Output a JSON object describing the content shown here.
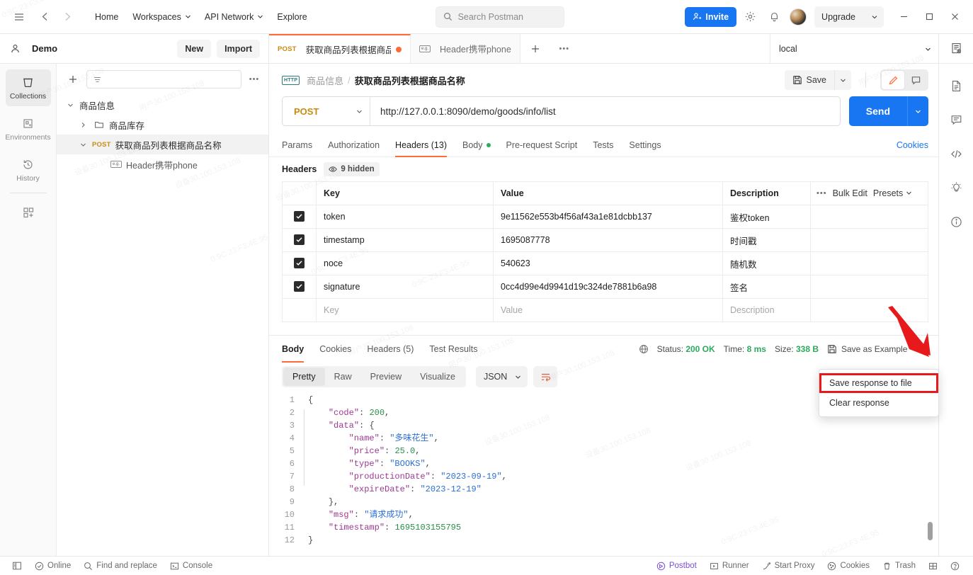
{
  "topbar": {
    "menu_icon": "hamburger-icon",
    "back_icon": "arrow-left-icon",
    "forward_icon": "arrow-right-icon",
    "home": "Home",
    "workspaces": "Workspaces",
    "api_network": "API Network",
    "explore": "Explore",
    "search_placeholder": "Search Postman",
    "invite": "Invite",
    "upgrade": "Upgrade"
  },
  "workspace": {
    "name": "Demo",
    "new_label": "New",
    "import_label": "Import"
  },
  "rail": {
    "items": [
      {
        "label": "Collections",
        "icon": "collections-icon"
      },
      {
        "label": "Environments",
        "icon": "environments-icon"
      },
      {
        "label": "History",
        "icon": "history-icon"
      }
    ],
    "more_icon": "apps-grid-plus-icon"
  },
  "tree": {
    "filter_placeholder": "",
    "nodes": [
      {
        "label": "商品信息",
        "type": "collection",
        "depth": 0,
        "expanded": true,
        "selected": false
      },
      {
        "label": "商品库存",
        "type": "folder",
        "depth": 1,
        "expanded": false,
        "selected": false
      },
      {
        "label": "获取商品列表根据商品名称",
        "type": "request",
        "method": "POST",
        "depth": 1,
        "expanded": true,
        "selected": true
      },
      {
        "label": "Header携带phone",
        "type": "example",
        "depth": 2,
        "expanded": false,
        "selected": false
      }
    ]
  },
  "tabs": {
    "items": [
      {
        "method": "POST",
        "label": "获取商品列表根据商品:",
        "active": true,
        "unsaved": true
      },
      {
        "method": "",
        "label": "Header携带phone",
        "active": false,
        "unsaved": false
      }
    ],
    "environment": "local"
  },
  "request": {
    "breadcrumb_parent": "商品信息",
    "breadcrumb_sep": "/",
    "breadcrumb_current": "获取商品列表根据商品名称",
    "save_label": "Save",
    "method": "POST",
    "url": "http://127.0.0.1:8090/demo/goods/info/list",
    "send_label": "Send",
    "tabs": [
      {
        "label": "Params",
        "active": false,
        "dot": false
      },
      {
        "label": "Authorization",
        "active": false,
        "dot": false
      },
      {
        "label": "Headers (13)",
        "active": true,
        "dot": false
      },
      {
        "label": "Body",
        "active": false,
        "dot": true
      },
      {
        "label": "Pre-request Script",
        "active": false,
        "dot": false
      },
      {
        "label": "Tests",
        "active": false,
        "dot": false
      },
      {
        "label": "Settings",
        "active": false,
        "dot": false
      }
    ],
    "cookies_link": "Cookies"
  },
  "headers_panel": {
    "caption": "Headers",
    "hidden_label": "9 hidden",
    "columns": [
      "Key",
      "Value",
      "Description"
    ],
    "bulk_edit": "Bulk Edit",
    "presets": "Presets",
    "rows": [
      {
        "checked": true,
        "key": "token",
        "value": "9e11562e553b4f56af43a1e81dcbb137",
        "description": "鉴权token"
      },
      {
        "checked": true,
        "key": "timestamp",
        "value": "1695087778",
        "description": "时间戳"
      },
      {
        "checked": true,
        "key": "noce",
        "value": "540623",
        "description": "随机数"
      },
      {
        "checked": true,
        "key": "signature",
        "value": "0cc4d99e4d9941d19c324de7881b6a98",
        "description": "签名"
      }
    ],
    "placeholder_row": {
      "key": "Key",
      "value": "Value",
      "description": "Description"
    }
  },
  "response": {
    "tabs": [
      {
        "label": "Body",
        "active": true
      },
      {
        "label": "Cookies",
        "active": false
      },
      {
        "label": "Headers (5)",
        "active": false
      },
      {
        "label": "Test Results",
        "active": false
      }
    ],
    "status_label": "Status:",
    "status_value": "200 OK",
    "time_label": "Time:",
    "time_value": "8 ms",
    "size_label": "Size:",
    "size_value": "338 B",
    "save_as_example": "Save as Example",
    "view_modes": [
      {
        "label": "Pretty",
        "active": true
      },
      {
        "label": "Raw",
        "active": false
      },
      {
        "label": "Preview",
        "active": false
      },
      {
        "label": "Visualize",
        "active": false
      }
    ],
    "format": "JSON",
    "wrap_icon": "wrap-lines-icon",
    "line_numbers": [
      1,
      2,
      3,
      4,
      5,
      6,
      7,
      8,
      9,
      10,
      11,
      12
    ],
    "body_lines": [
      [
        {
          "t": "{",
          "c": "pun"
        }
      ],
      [
        {
          "t": "    ",
          "c": "pun"
        },
        {
          "t": "\"code\"",
          "c": "key"
        },
        {
          "t": ": ",
          "c": "pun"
        },
        {
          "t": "200",
          "c": "num"
        },
        {
          "t": ",",
          "c": "pun"
        }
      ],
      [
        {
          "t": "    ",
          "c": "pun"
        },
        {
          "t": "\"data\"",
          "c": "key"
        },
        {
          "t": ": ",
          "c": "pun"
        },
        {
          "t": "{",
          "c": "pun"
        }
      ],
      [
        {
          "t": "        ",
          "c": "pun"
        },
        {
          "t": "\"name\"",
          "c": "key"
        },
        {
          "t": ": ",
          "c": "pun"
        },
        {
          "t": "\"多味花生\"",
          "c": "str"
        },
        {
          "t": ",",
          "c": "pun"
        }
      ],
      [
        {
          "t": "        ",
          "c": "pun"
        },
        {
          "t": "\"price\"",
          "c": "key"
        },
        {
          "t": ": ",
          "c": "pun"
        },
        {
          "t": "25.0",
          "c": "num"
        },
        {
          "t": ",",
          "c": "pun"
        }
      ],
      [
        {
          "t": "        ",
          "c": "pun"
        },
        {
          "t": "\"type\"",
          "c": "key"
        },
        {
          "t": ": ",
          "c": "pun"
        },
        {
          "t": "\"BOOKS\"",
          "c": "str"
        },
        {
          "t": ",",
          "c": "pun"
        }
      ],
      [
        {
          "t": "        ",
          "c": "pun"
        },
        {
          "t": "\"productionDate\"",
          "c": "key"
        },
        {
          "t": ": ",
          "c": "pun"
        },
        {
          "t": "\"2023-09-19\"",
          "c": "str"
        },
        {
          "t": ",",
          "c": "pun"
        }
      ],
      [
        {
          "t": "        ",
          "c": "pun"
        },
        {
          "t": "\"expireDate\"",
          "c": "key"
        },
        {
          "t": ": ",
          "c": "pun"
        },
        {
          "t": "\"2023-12-19\"",
          "c": "str"
        }
      ],
      [
        {
          "t": "    ",
          "c": "pun"
        },
        {
          "t": "},",
          "c": "pun"
        }
      ],
      [
        {
          "t": "    ",
          "c": "pun"
        },
        {
          "t": "\"msg\"",
          "c": "key"
        },
        {
          "t": ": ",
          "c": "pun"
        },
        {
          "t": "\"请求成功\"",
          "c": "str"
        },
        {
          "t": ",",
          "c": "pun"
        }
      ],
      [
        {
          "t": "    ",
          "c": "pun"
        },
        {
          "t": "\"timestamp\"",
          "c": "key"
        },
        {
          "t": ": ",
          "c": "pun"
        },
        {
          "t": "1695103155795",
          "c": "num"
        }
      ],
      [
        {
          "t": "}",
          "c": "pun"
        }
      ]
    ]
  },
  "context_menu": {
    "items": [
      {
        "label": "Save response to file",
        "highlighted": true
      },
      {
        "label": "Clear response",
        "highlighted": false
      }
    ]
  },
  "right_rail": {
    "items": [
      "collection-overview-icon",
      "documentation-icon",
      "comments-icon",
      "code-icon",
      "lightbulb-icon",
      "info-icon"
    ]
  },
  "statusbar": {
    "sidebar_icon": "panel-toggle-icon",
    "online": "Online",
    "find_replace": "Find and replace",
    "console": "Console",
    "postbot": "Postbot",
    "runner": "Runner",
    "start_proxy": "Start Proxy",
    "cookies": "Cookies",
    "trash": "Trash",
    "layout_icon": "layout-icon",
    "help_icon": "help-icon"
  },
  "colors": {
    "accent": "#ff6c37",
    "primary": "#1876f2",
    "success": "#2bab5b",
    "method_post": "#c98a12",
    "annotation": "#e8191b"
  }
}
